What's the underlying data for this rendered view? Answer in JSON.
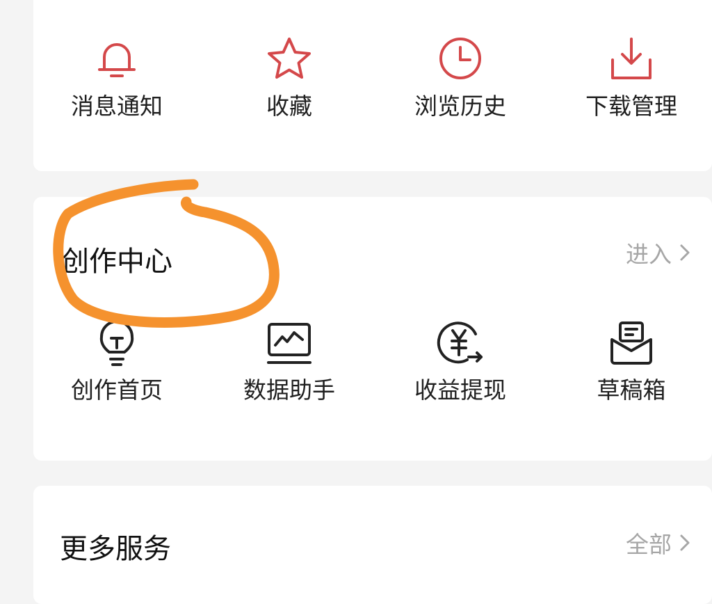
{
  "quick_actions": [
    {
      "label": "消息通知",
      "icon": "bell-icon"
    },
    {
      "label": "收藏",
      "icon": "star-icon"
    },
    {
      "label": "浏览历史",
      "icon": "clock-icon"
    },
    {
      "label": "下载管理",
      "icon": "download-tray-icon"
    }
  ],
  "creation_center": {
    "title": "创作中心",
    "enter_label": "进入",
    "items": [
      {
        "label": "创作首页",
        "icon": "lightbulb-icon"
      },
      {
        "label": "数据助手",
        "icon": "chart-monitor-icon"
      },
      {
        "label": "收益提现",
        "icon": "yuan-withdraw-icon"
      },
      {
        "label": "草稿箱",
        "icon": "draft-box-icon"
      }
    ]
  },
  "more_services": {
    "title": "更多服务",
    "all_label": "全部"
  },
  "colors": {
    "accent_red": "#d4484a",
    "icon_dark": "#222222",
    "muted_text": "#a6a6a6",
    "annotation_orange": "#f5922e"
  }
}
